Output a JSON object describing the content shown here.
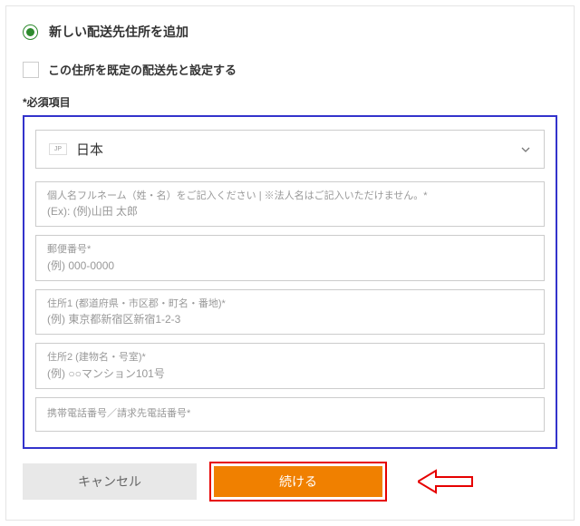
{
  "header": {
    "title": "新しい配送先住所を追加"
  },
  "default_checkbox": {
    "label": "この住所を既定の配送先と設定する"
  },
  "required_note": "*必須項目",
  "country": {
    "code": "JP",
    "name": "日本"
  },
  "fields": {
    "fullname": {
      "label": "個人名フルネーム（姓・名）をご記入ください | ※法人名はご記入いただけません。*",
      "hint": "(Ex): (例)山田 太郎"
    },
    "postal": {
      "label": "郵便番号*",
      "hint": "(例) 000-0000"
    },
    "address1": {
      "label": "住所1 (都道府県・市区郡・町名・番地)*",
      "hint": "(例) 東京都新宿区新宿1-2-3"
    },
    "address2": {
      "label": "住所2 (建物名・号室)*",
      "hint": "(例) ○○マンション101号"
    },
    "phone": {
      "label": "携帯電話番号／請求先電話番号*"
    }
  },
  "buttons": {
    "cancel": "キャンセル",
    "continue": "続ける"
  }
}
